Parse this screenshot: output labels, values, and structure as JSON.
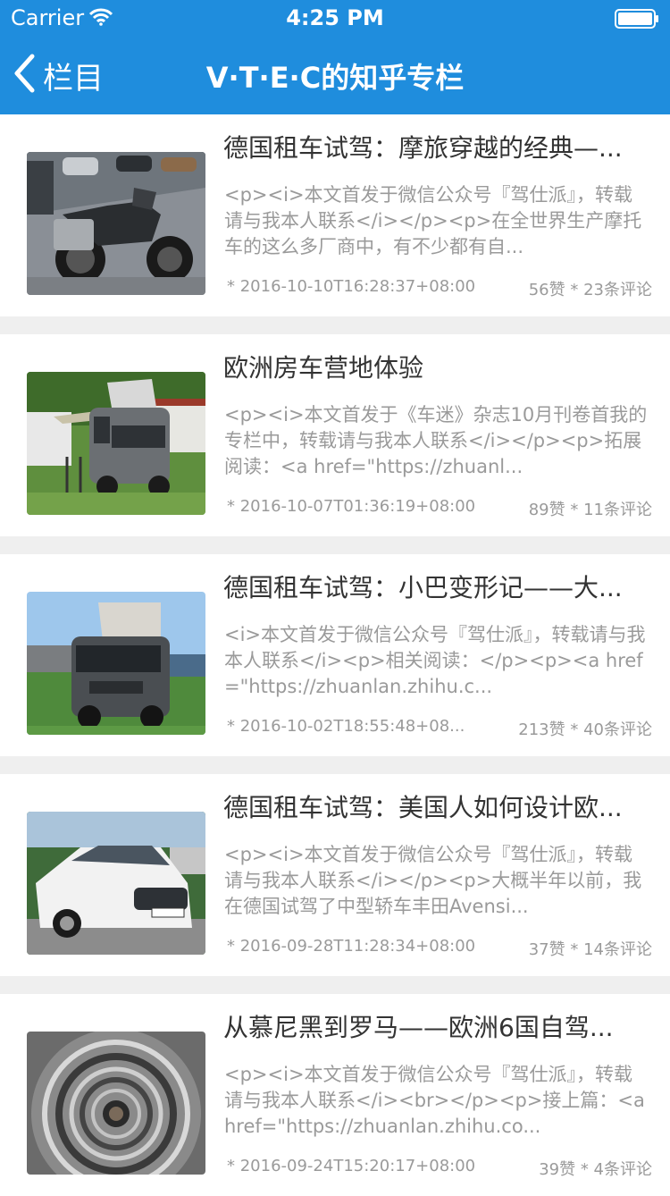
{
  "status_bar": {
    "carrier": "Carrier",
    "time": "4:25 PM"
  },
  "nav": {
    "back_label": "栏目",
    "title": "V·T·E·C的知乎专栏"
  },
  "colors": {
    "header_bg": "#1f8ddd",
    "title_text": "#333333",
    "secondary_text": "#9a9a9a"
  },
  "articles": [
    {
      "title": "德国租车试驾：摩旅穿越的经典—...",
      "excerpt": "<p><i>本文首发于微信公众号『驾仕派』，转载请与我本人联系</i></p><p>在全世界生产摩托车的这么多厂商中，有不少都有自...",
      "date": "* 2016-10-10T16:28:37+08:00",
      "stats": "56赞 * 23条评论",
      "image": "motorcycle"
    },
    {
      "title": "欧洲房车营地体验",
      "excerpt": "<p><i>本文首发于《车迷》杂志10月刊卷首我的专栏中，转载请与我本人联系</i></p><p>拓展阅读：<a href=\"https://zhuanl...",
      "date": "* 2016-10-07T01:36:19+08:00",
      "stats": "89赞 * 11条评论",
      "image": "camper-van"
    },
    {
      "title": "德国租车试驾：小巴变形记——大...",
      "excerpt": "<i>本文首发于微信公众号『驾仕派』，转载请与我本人联系</i><p>相关阅读：</p><p><a href=\"https://zhuanlan.zhihu.c...",
      "date": "* 2016-10-02T18:55:48+08...",
      "stats": "213赞 * 40条评论",
      "image": "camper-van-dark"
    },
    {
      "title": "德国租车试驾：美国人如何设计欧...",
      "excerpt": "<p><i>本文首发于微信公众号『驾仕派』，转载请与我本人联系</i></p><p>大概半年以前，我在德国试驾了中型轿车丰田Avensi...",
      "date": "* 2016-09-28T11:28:34+08:00",
      "stats": "37赞 * 14条评论",
      "image": "white-sedan"
    },
    {
      "title": "从慕尼黑到罗马——欧洲6国自驾...",
      "excerpt": "<p><i>本文首发于微信公众号『驾仕派』，转载请与我本人联系</i><br></p><p>接上篇：<a href=\"https://zhuanlan.zhihu.co...",
      "date": "* 2016-09-24T15:20:17+08:00",
      "stats": "39赞 * 4条评论",
      "image": "spiral-staircase"
    }
  ]
}
